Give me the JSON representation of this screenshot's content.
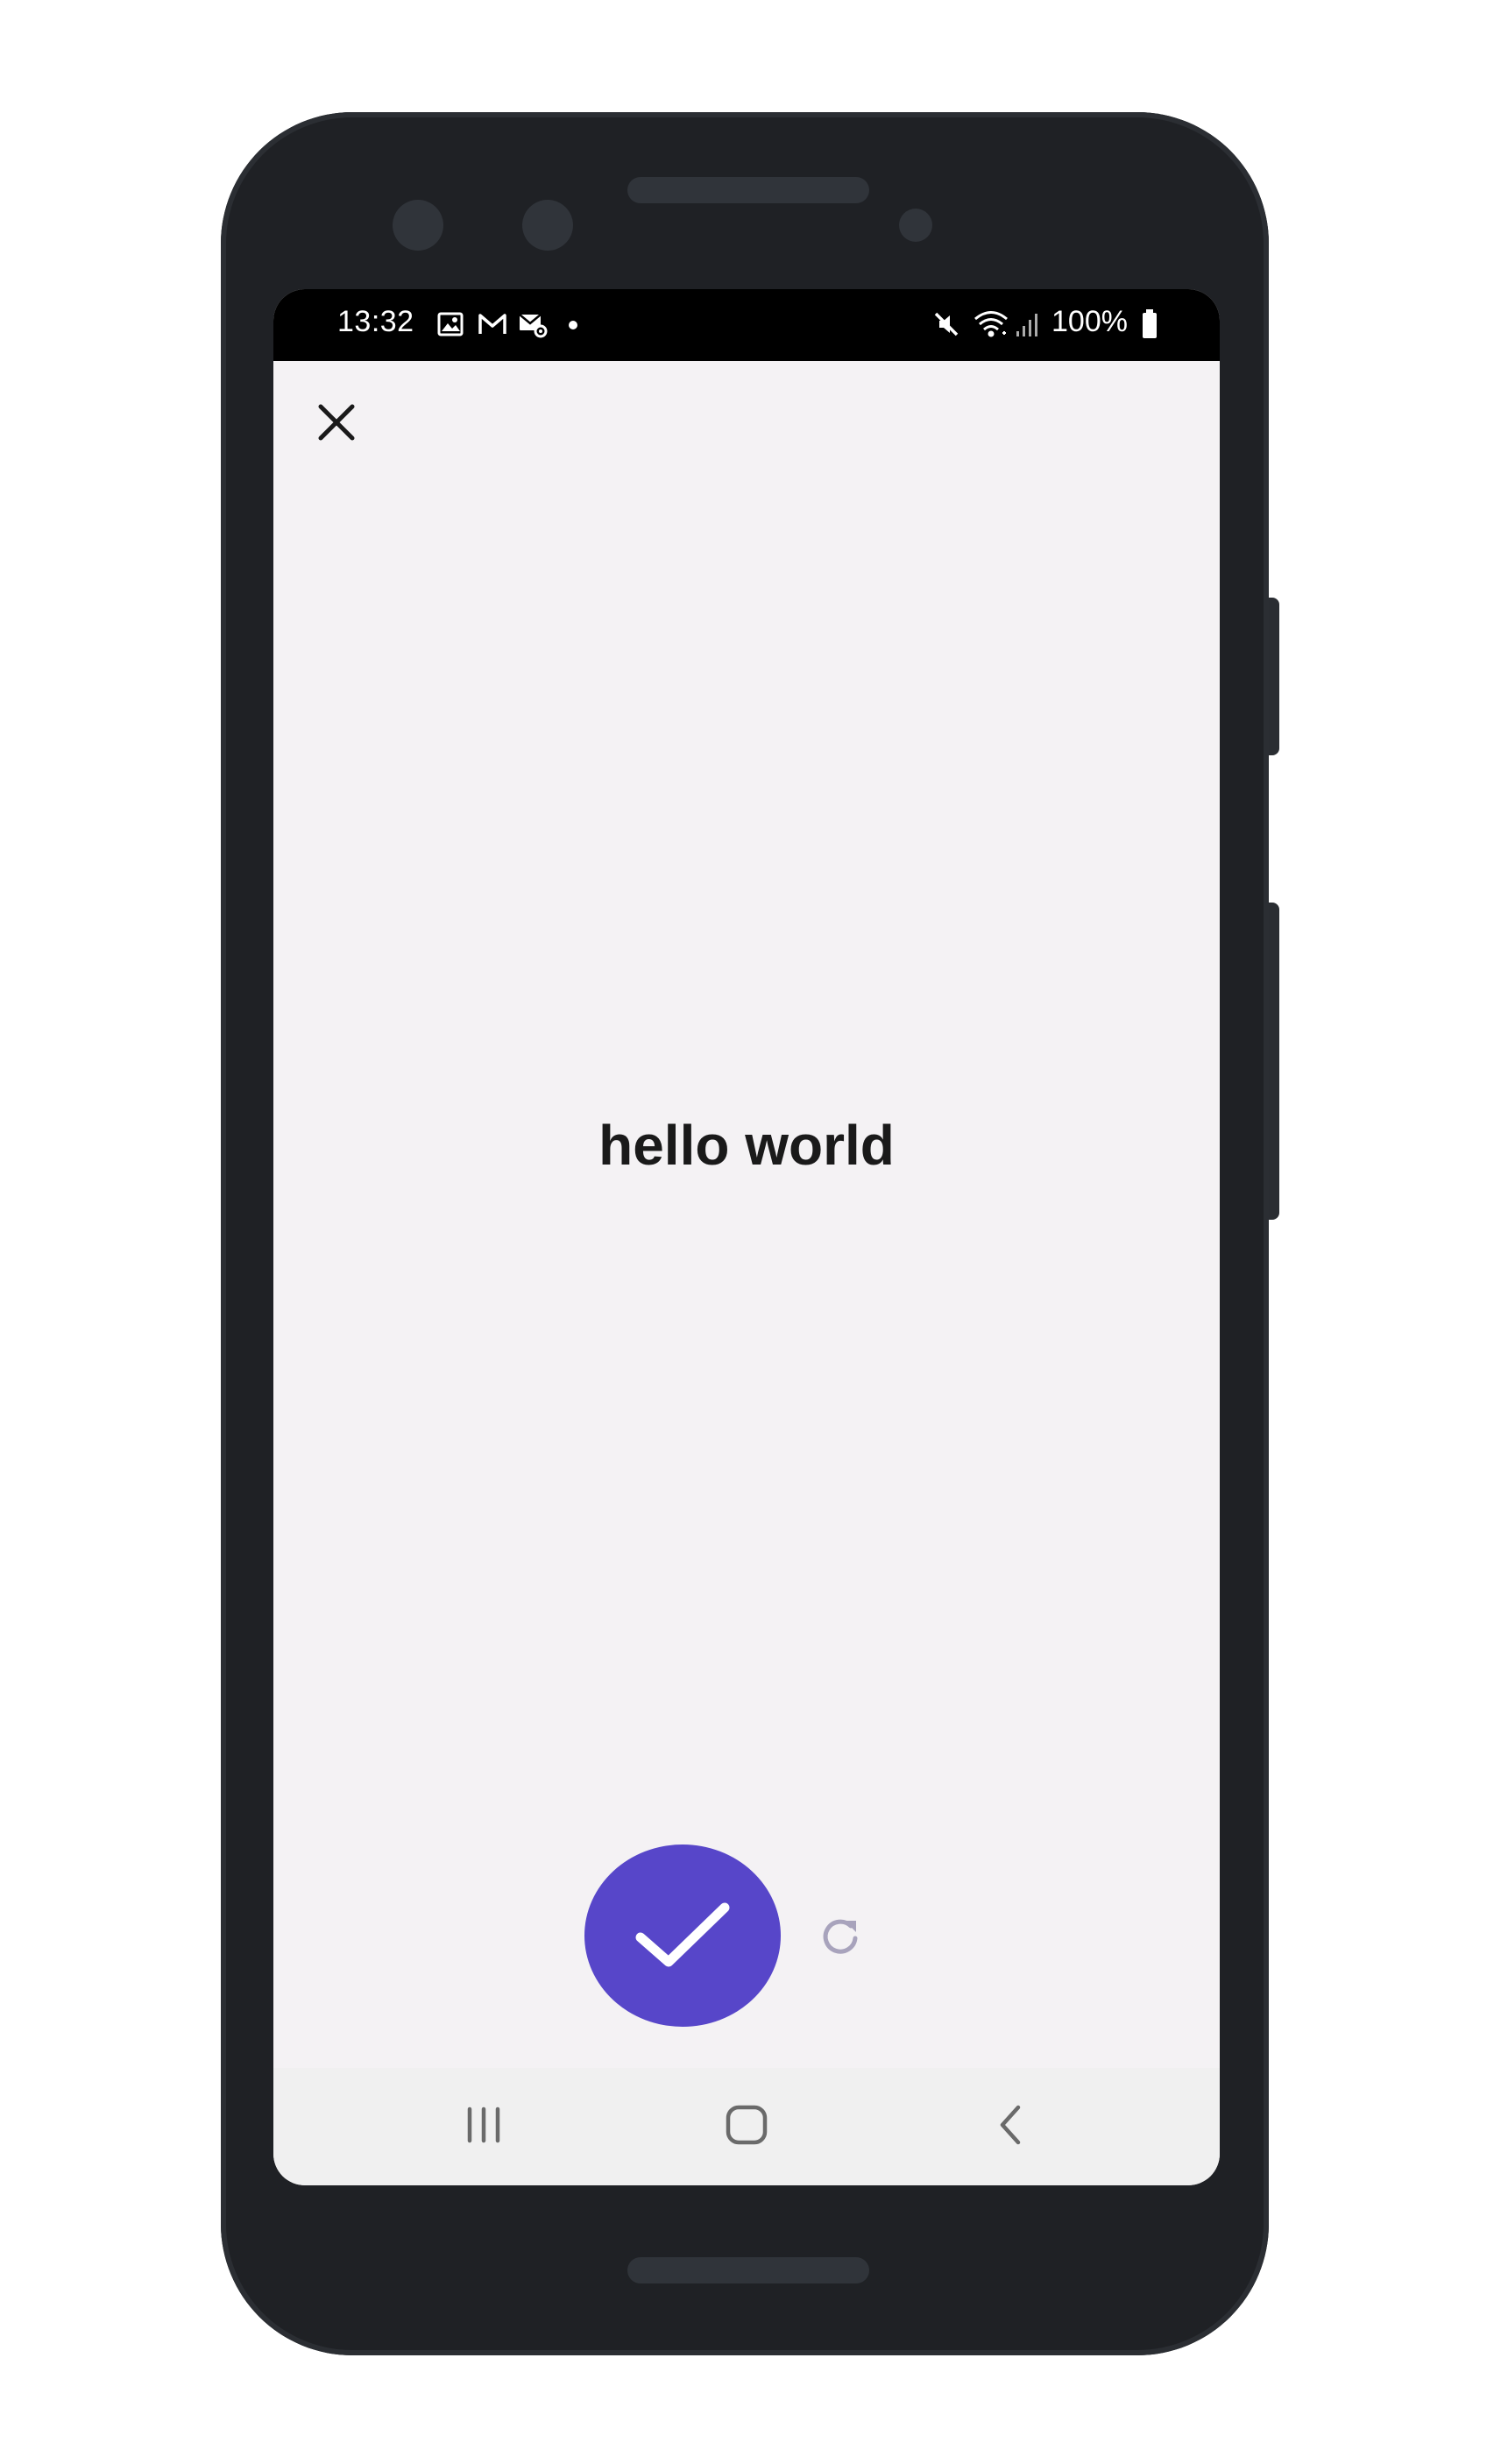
{
  "status_bar": {
    "time": "13:32",
    "battery": "100%",
    "icons": [
      "gallery-icon",
      "gmail-icon",
      "mail-settings-icon",
      "notification-dot",
      "mute-icon",
      "wifi-icon",
      "signal-icon",
      "battery-icon"
    ]
  },
  "screen": {
    "close_icon": "close-icon",
    "message": "hello world",
    "confirm_icon": "check-icon",
    "refresh_icon": "refresh-icon",
    "accent_color": "#5746c9"
  },
  "nav_bar": {
    "buttons": [
      "recents-icon",
      "home-icon",
      "back-icon"
    ]
  }
}
